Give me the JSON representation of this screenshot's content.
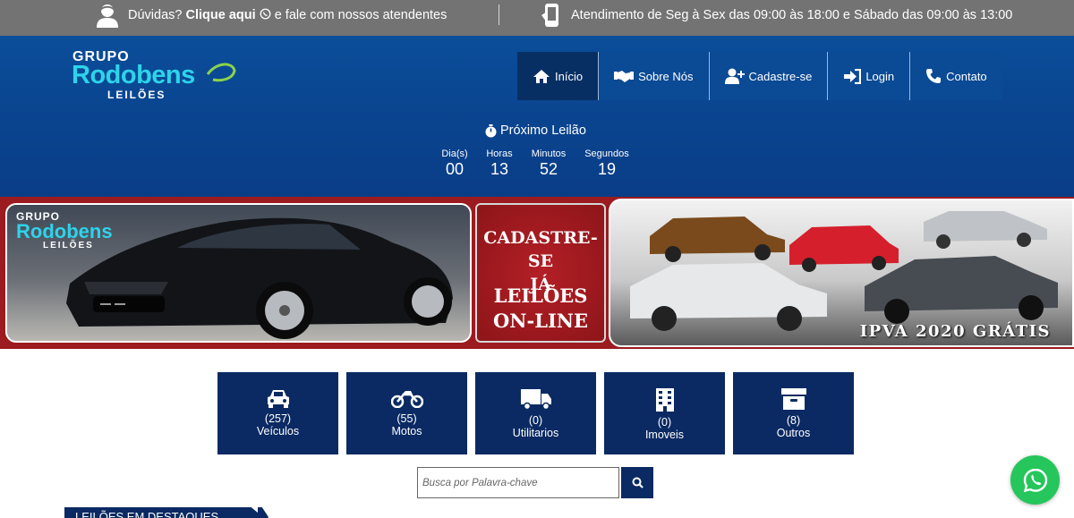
{
  "topbar": {
    "help_prefix": "Dúvidas?",
    "help_link": "Clique aqui",
    "help_suffix": "e fale com nossos atendentes",
    "hours": "Atendimento de Seg à Sex das 09:00 às 18:00 e Sábado das 09:00 às 13:00"
  },
  "logo": {
    "line1": "GRUPO",
    "line2": "Rodobens",
    "line3": "LEILÕES"
  },
  "nav": {
    "items": [
      {
        "label": "Início",
        "icon": "home-icon",
        "active": true
      },
      {
        "label": "Sobre Nós",
        "icon": "handshake-icon"
      },
      {
        "label": "Cadastre-se",
        "icon": "user-plus-icon"
      },
      {
        "label": "Login",
        "icon": "sign-in-icon"
      },
      {
        "label": "Contato",
        "icon": "phone-icon"
      }
    ]
  },
  "countdown": {
    "title": "Próximo Leilão",
    "cells": [
      {
        "label": "Dia(s)",
        "value": "00"
      },
      {
        "label": "Horas",
        "value": "13"
      },
      {
        "label": "Minutos",
        "value": "52"
      },
      {
        "label": "Segundos",
        "value": "19"
      }
    ]
  },
  "banner": {
    "logo": {
      "line1": "GRUPO",
      "line2": "Rodobens",
      "line3": "LEILÕES"
    },
    "cta_line1": "CADASTRE-SE",
    "cta_line2": "JÁ",
    "cta_line3": "LEILÕES",
    "cta_line4": "ON-LINE",
    "promo": "IPVA 2020 GRÁTIS"
  },
  "categories": [
    {
      "count": "(257)",
      "name": "Veículos",
      "icon": "car-icon"
    },
    {
      "count": "(55)",
      "name": "Motos",
      "icon": "motorcycle-icon"
    },
    {
      "count": "(0)",
      "name": "Utilitarios",
      "icon": "truck-icon"
    },
    {
      "count": "(0)",
      "name": "Imoveis",
      "icon": "building-icon"
    },
    {
      "count": "(8)",
      "name": "Outros",
      "icon": "archive-icon"
    }
  ],
  "search": {
    "placeholder": "Busca por Palavra-chave",
    "value": ""
  },
  "featured": {
    "label": "LEILÕES EM DESTAQUES"
  },
  "colors": {
    "navy": "#0b2a63",
    "header_blue": "#0b4e9a",
    "banner_red": "#9b1b20",
    "whatsapp_green": "#25c65c",
    "topbar_gray": "#737373",
    "logo_cyan": "#2ed3ea"
  }
}
